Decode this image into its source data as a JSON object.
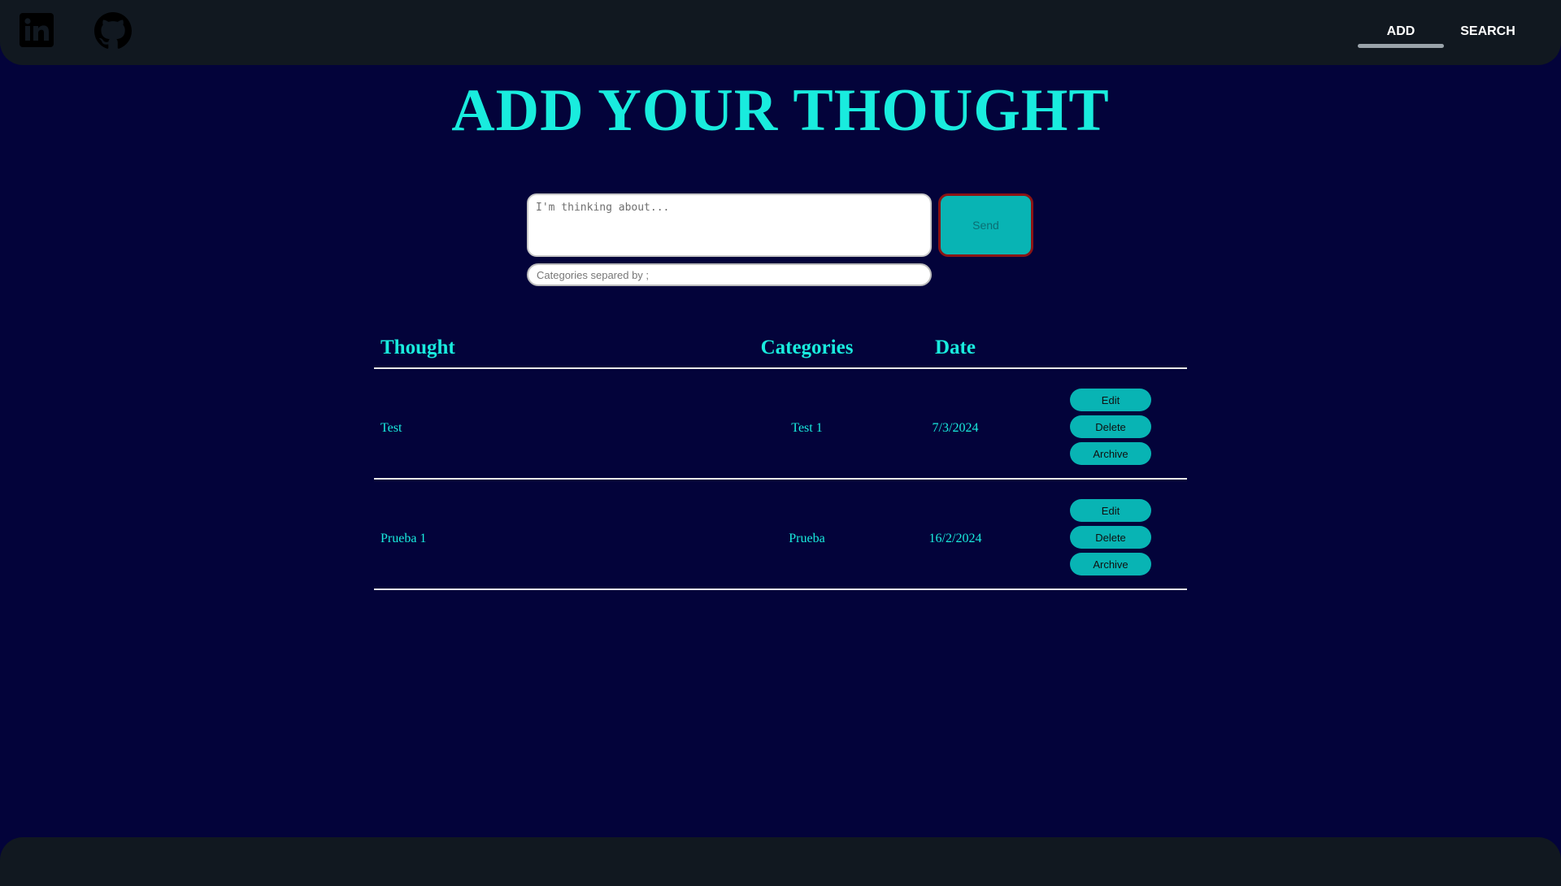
{
  "header": {
    "social": [
      {
        "name": "linkedin-icon"
      },
      {
        "name": "github-icon"
      }
    ],
    "nav": {
      "add_label": "ADD",
      "search_label": "SEARCH",
      "active": "ADD"
    }
  },
  "main": {
    "title": "ADD YOUR THOUGHT",
    "form": {
      "thought_placeholder": "I'm thinking about...",
      "thought_value": "",
      "categories_placeholder": "Categories separed by ;",
      "categories_value": "",
      "send_label": "Send"
    },
    "table": {
      "headers": {
        "thought": "Thought",
        "categories": "Categories",
        "date": "Date"
      },
      "rows": [
        {
          "thought": "Test",
          "categories": "Test 1",
          "date": "7/3/2024",
          "edit_label": "Edit",
          "delete_label": "Delete",
          "archive_label": "Archive"
        },
        {
          "thought": "Prueba 1",
          "categories": "Prueba",
          "date": "16/2/2024",
          "edit_label": "Edit",
          "delete_label": "Delete",
          "archive_label": "Archive"
        }
      ]
    }
  },
  "colors": {
    "background": "#03033a",
    "bar": "#111820",
    "accent": "#19ecde",
    "button": "#08b4b4",
    "send_border": "#8b1414"
  }
}
